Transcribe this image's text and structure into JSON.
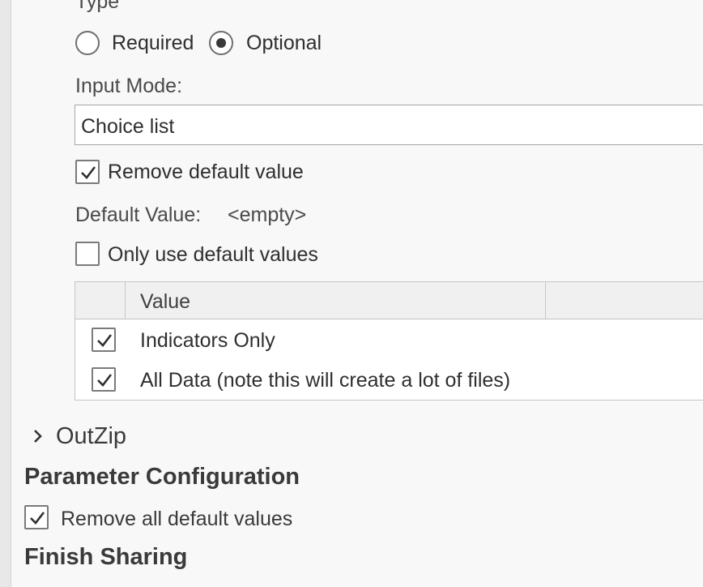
{
  "type_section": {
    "label": "Type",
    "options": [
      {
        "label": "Required",
        "selected": false
      },
      {
        "label": "Optional",
        "selected": true
      }
    ]
  },
  "input_mode": {
    "label": "Input Mode:",
    "value": "Choice list"
  },
  "remove_default": {
    "label": "Remove default value",
    "checked": true
  },
  "default_value": {
    "label": "Default Value:",
    "value": "<empty>"
  },
  "only_default": {
    "label": "Only use default values",
    "checked": false
  },
  "values_table": {
    "column_header": "Value",
    "rows": [
      {
        "label": "Indicators Only",
        "checked": true
      },
      {
        "label": "All Data (note this will create a lot of files)",
        "checked": true
      }
    ]
  },
  "outzip": {
    "label": "OutZip",
    "icon": "chevron-right-icon"
  },
  "parameter_configuration": {
    "title": "Parameter Configuration",
    "remove_all_default": {
      "label": "Remove all default values",
      "checked": true
    }
  },
  "finish_sharing": {
    "title": "Finish Sharing"
  }
}
